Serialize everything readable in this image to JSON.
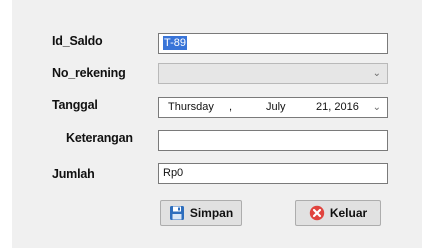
{
  "form": {
    "id_saldo": {
      "label": "Id_Saldo",
      "value": "T-89"
    },
    "no_rekening": {
      "label": "No_rekening",
      "value": ""
    },
    "tanggal": {
      "label": "Tanggal",
      "day_name": "Thursday",
      "separator": ",",
      "month": "July",
      "day_year": "21, 2016"
    },
    "keterangan": {
      "label": "Keterangan",
      "value": ""
    },
    "jumlah": {
      "label": "Jumlah",
      "value": "Rp0"
    }
  },
  "buttons": {
    "simpan": {
      "label": "Simpan",
      "icon": "floppy-disk-icon",
      "icon_color": "#2e6ebd"
    },
    "keluar": {
      "label": "Keluar",
      "icon": "close-circle-icon",
      "icon_color": "#e0443e"
    }
  },
  "colors": {
    "selection": "#3874d8",
    "panel": "#f0f0f0"
  }
}
